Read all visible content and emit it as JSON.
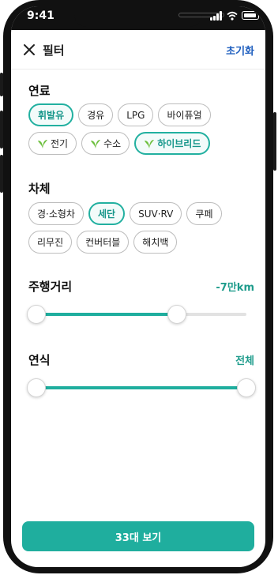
{
  "status_bar": {
    "time": "9:41"
  },
  "header": {
    "title": "필터",
    "reset_label": "초기화"
  },
  "fuel": {
    "title": "연료",
    "options": [
      {
        "label": "휘발유",
        "selected": true,
        "eco": false
      },
      {
        "label": "경유",
        "selected": false,
        "eco": false
      },
      {
        "label": "LPG",
        "selected": false,
        "eco": false
      },
      {
        "label": "바이퓨얼",
        "selected": false,
        "eco": false
      },
      {
        "label": "전기",
        "selected": false,
        "eco": true
      },
      {
        "label": "수소",
        "selected": false,
        "eco": true
      },
      {
        "label": "하이브리드",
        "selected": true,
        "eco": true
      }
    ]
  },
  "body_type": {
    "title": "차체",
    "options": [
      {
        "label": "경·소형차",
        "selected": false
      },
      {
        "label": "세단",
        "selected": true
      },
      {
        "label": "SUV·RV",
        "selected": false
      },
      {
        "label": "쿠페",
        "selected": false
      },
      {
        "label": "리무진",
        "selected": false
      },
      {
        "label": "컨버터블",
        "selected": false
      },
      {
        "label": "해치백",
        "selected": false
      }
    ]
  },
  "mileage": {
    "title": "주행거리",
    "value_label": "-7만km",
    "range_fraction": [
      0,
      0.67
    ]
  },
  "year": {
    "title": "연식",
    "value_label": "전체",
    "range_fraction": [
      0,
      1
    ]
  },
  "cta": {
    "label": "33대 보기"
  },
  "colors": {
    "accent": "#1fae9e",
    "accent_text": "#16968a",
    "reset_link": "#1f5fbf",
    "eco_leaf": "#6cbf3c"
  }
}
